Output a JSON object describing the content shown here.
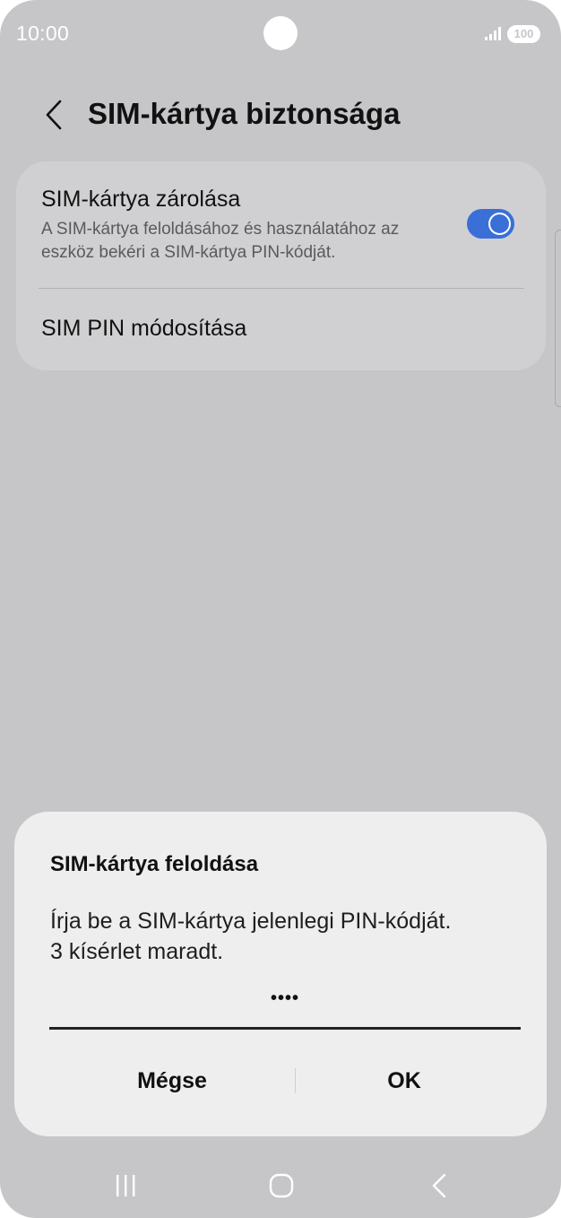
{
  "status_bar": {
    "time": "10:00",
    "battery": "100",
    "icons": [
      "signal-icon",
      "battery-icon"
    ]
  },
  "header": {
    "title": "SIM-kártya biztonsága",
    "back_icon": "chevron-left-icon"
  },
  "settings": {
    "lock": {
      "title": "SIM-kártya zárolása",
      "subtitle": "A SIM-kártya feloldásához és használatához az eszköz bekéri a SIM-kártya PIN-kódját.",
      "enabled": true
    },
    "change_pin": {
      "title": "SIM PIN módosítása"
    }
  },
  "dialog": {
    "title": "SIM-kártya feloldása",
    "message_line1": "Írja be a SIM-kártya jelenlegi PIN-kódját.",
    "message_line2": "3 kísérlet maradt.",
    "pin_value": "••••",
    "cancel_label": "Mégse",
    "ok_label": "OK"
  },
  "nav_bar": {
    "icons": [
      "recents-icon",
      "home-icon",
      "back-icon"
    ]
  },
  "colors": {
    "background": "#c6c6c8",
    "card": "#d0d0d2",
    "dialog": "#eeeeee",
    "accent": "#3a6fd8"
  }
}
